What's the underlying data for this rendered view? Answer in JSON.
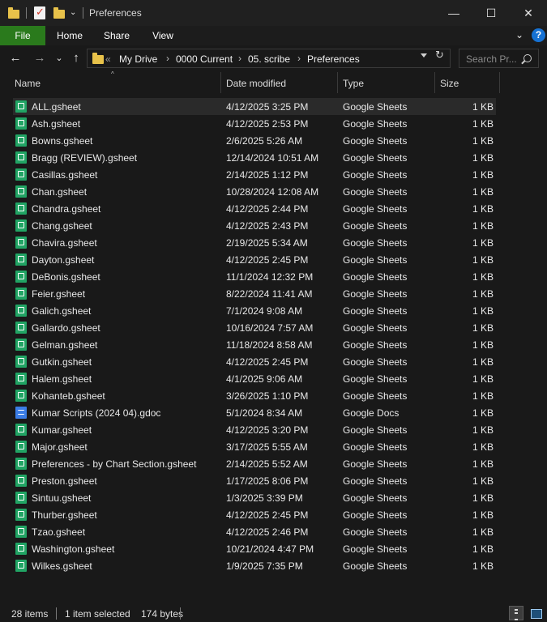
{
  "window": {
    "title": "Preferences",
    "minimize_glyph": "—",
    "maximize_glyph": "☐",
    "close_glyph": "✕"
  },
  "ribbon": {
    "tabs": [
      "File",
      "Home",
      "Share",
      "View"
    ],
    "collapse_glyph": "⌄",
    "help_glyph": "?",
    "accent_color": "#2a7a1c"
  },
  "nav": {
    "back_glyph": "←",
    "forward_glyph": "→",
    "recent_glyph": "⌄",
    "up_glyph": "↑",
    "overflow": "«",
    "breadcrumb": [
      "My Drive",
      "0000 Current",
      "05. scribe",
      "Preferences"
    ],
    "crumb_separator": "›",
    "refresh_glyph": "↻",
    "search_placeholder": "Search Pr..."
  },
  "columns": {
    "name": "Name",
    "date": "Date modified",
    "type": "Type",
    "size": "Size",
    "sort_glyph": "^"
  },
  "files": [
    {
      "name": "ALL.gsheet",
      "date": "4/12/2025 3:25 PM",
      "type": "Google Sheets",
      "size": "1 KB",
      "icon": "google-sheets-icon",
      "selected": true
    },
    {
      "name": "Ash.gsheet",
      "date": "4/12/2025 2:53 PM",
      "type": "Google Sheets",
      "size": "1 KB",
      "icon": "google-sheets-icon"
    },
    {
      "name": "Bowns.gsheet",
      "date": "2/6/2025 5:26 AM",
      "type": "Google Sheets",
      "size": "1 KB",
      "icon": "google-sheets-icon"
    },
    {
      "name": "Bragg (REVIEW).gsheet",
      "date": "12/14/2024 10:51 AM",
      "type": "Google Sheets",
      "size": "1 KB",
      "icon": "google-sheets-icon"
    },
    {
      "name": "Casillas.gsheet",
      "date": "2/14/2025 1:12 PM",
      "type": "Google Sheets",
      "size": "1 KB",
      "icon": "google-sheets-icon"
    },
    {
      "name": "Chan.gsheet",
      "date": "10/28/2024 12:08 AM",
      "type": "Google Sheets",
      "size": "1 KB",
      "icon": "google-sheets-icon"
    },
    {
      "name": "Chandra.gsheet",
      "date": "4/12/2025 2:44 PM",
      "type": "Google Sheets",
      "size": "1 KB",
      "icon": "google-sheets-icon"
    },
    {
      "name": "Chang.gsheet",
      "date": "4/12/2025 2:43 PM",
      "type": "Google Sheets",
      "size": "1 KB",
      "icon": "google-sheets-icon"
    },
    {
      "name": "Chavira.gsheet",
      "date": "2/19/2025 5:34 AM",
      "type": "Google Sheets",
      "size": "1 KB",
      "icon": "google-sheets-icon"
    },
    {
      "name": "Dayton.gsheet",
      "date": "4/12/2025 2:45 PM",
      "type": "Google Sheets",
      "size": "1 KB",
      "icon": "google-sheets-icon"
    },
    {
      "name": "DeBonis.gsheet",
      "date": "11/1/2024 12:32 PM",
      "type": "Google Sheets",
      "size": "1 KB",
      "icon": "google-sheets-icon"
    },
    {
      "name": "Feier.gsheet",
      "date": "8/22/2024 11:41 AM",
      "type": "Google Sheets",
      "size": "1 KB",
      "icon": "google-sheets-icon"
    },
    {
      "name": "Galich.gsheet",
      "date": "7/1/2024 9:08 AM",
      "type": "Google Sheets",
      "size": "1 KB",
      "icon": "google-sheets-icon"
    },
    {
      "name": "Gallardo.gsheet",
      "date": "10/16/2024 7:57 AM",
      "type": "Google Sheets",
      "size": "1 KB",
      "icon": "google-sheets-icon"
    },
    {
      "name": "Gelman.gsheet",
      "date": "11/18/2024 8:58 AM",
      "type": "Google Sheets",
      "size": "1 KB",
      "icon": "google-sheets-icon"
    },
    {
      "name": "Gutkin.gsheet",
      "date": "4/12/2025 2:45 PM",
      "type": "Google Sheets",
      "size": "1 KB",
      "icon": "google-sheets-icon"
    },
    {
      "name": "Halem.gsheet",
      "date": "4/1/2025 9:06 AM",
      "type": "Google Sheets",
      "size": "1 KB",
      "icon": "google-sheets-icon"
    },
    {
      "name": "Kohanteb.gsheet",
      "date": "3/26/2025 1:10 PM",
      "type": "Google Sheets",
      "size": "1 KB",
      "icon": "google-sheets-icon"
    },
    {
      "name": "Kumar Scripts (2024 04).gdoc",
      "date": "5/1/2024 8:34 AM",
      "type": "Google Docs",
      "size": "1 KB",
      "icon": "google-docs-icon"
    },
    {
      "name": "Kumar.gsheet",
      "date": "4/12/2025 3:20 PM",
      "type": "Google Sheets",
      "size": "1 KB",
      "icon": "google-sheets-icon"
    },
    {
      "name": "Major.gsheet",
      "date": "3/17/2025 5:55 AM",
      "type": "Google Sheets",
      "size": "1 KB",
      "icon": "google-sheets-icon"
    },
    {
      "name": "Preferences - by Chart Section.gsheet",
      "date": "2/14/2025 5:52 AM",
      "type": "Google Sheets",
      "size": "1 KB",
      "icon": "google-sheets-icon"
    },
    {
      "name": "Preston.gsheet",
      "date": "1/17/2025 8:06 PM",
      "type": "Google Sheets",
      "size": "1 KB",
      "icon": "google-sheets-icon"
    },
    {
      "name": "Sintuu.gsheet",
      "date": "1/3/2025 3:39 PM",
      "type": "Google Sheets",
      "size": "1 KB",
      "icon": "google-sheets-icon"
    },
    {
      "name": "Thurber.gsheet",
      "date": "4/12/2025 2:45 PM",
      "type": "Google Sheets",
      "size": "1 KB",
      "icon": "google-sheets-icon"
    },
    {
      "name": "Tzao.gsheet",
      "date": "4/12/2025 2:46 PM",
      "type": "Google Sheets",
      "size": "1 KB",
      "icon": "google-sheets-icon"
    },
    {
      "name": "Washington.gsheet",
      "date": "10/21/2024 4:47 PM",
      "type": "Google Sheets",
      "size": "1 KB",
      "icon": "google-sheets-icon"
    },
    {
      "name": "Wilkes.gsheet",
      "date": "1/9/2025 7:35 PM",
      "type": "Google Sheets",
      "size": "1 KB",
      "icon": "google-sheets-icon"
    }
  ],
  "status": {
    "item_count": "28 items",
    "selection": "1 item selected",
    "selection_size": "174 bytes"
  }
}
